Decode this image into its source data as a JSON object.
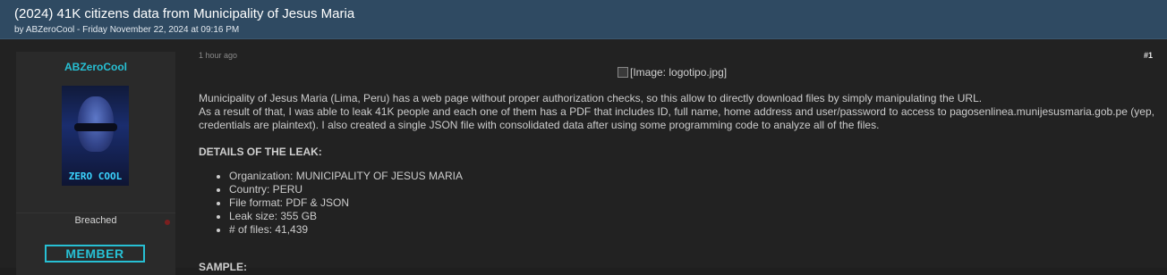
{
  "thread": {
    "title": "(2024) 41K citizens data from Municipality of Jesus Maria",
    "meta": "by ABZeroCool - Friday November 22, 2024 at 09:16 PM"
  },
  "author": {
    "username": "ABZeroCool",
    "avatar_text": "ZERO COOL",
    "usergroup": "Breached",
    "rank": "MEMBER"
  },
  "post": {
    "time": "1 hour ago",
    "number": "#1",
    "image_alt": "[Image: logotipo.jpg]",
    "paragraph1": "Municipality of Jesus Maria (Lima, Peru) has a web page without proper authorization checks, so this allow to directly download files by simply manipulating the URL.",
    "paragraph2": "As a result of that, I was able to leak 41K people and each one of them has a PDF that includes ID, full name, home address and user/password to access to pagosenlinea.munijesusmaria.gob.pe (yep, credentials are plaintext). I also created a single JSON file with consolidated data after using some programming code to analyze all of the files.",
    "details_title": "DETAILS OF THE LEAK:",
    "details": [
      "Organization: MUNICIPALITY OF JESUS MARIA",
      "Country: PERU",
      "File format: PDF & JSON",
      "Leak size: 355 GB",
      "# of files: 41,439"
    ],
    "sample_title": "SAMPLE:"
  }
}
